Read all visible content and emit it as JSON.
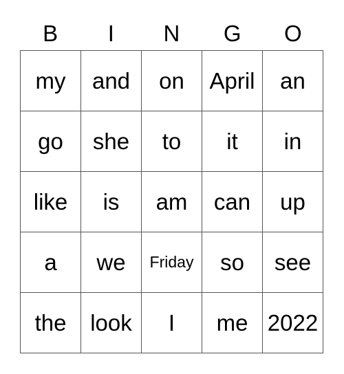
{
  "header": [
    "B",
    "I",
    "N",
    "G",
    "O"
  ],
  "cells": [
    [
      "my",
      "and",
      "on",
      "April",
      "an"
    ],
    [
      "go",
      "she",
      "to",
      "it",
      "in"
    ],
    [
      "like",
      "is",
      "am",
      "can",
      "up"
    ],
    [
      "a",
      "we",
      "Friday",
      "so",
      "see"
    ],
    [
      "the",
      "look",
      "I",
      "me",
      "2022"
    ]
  ]
}
